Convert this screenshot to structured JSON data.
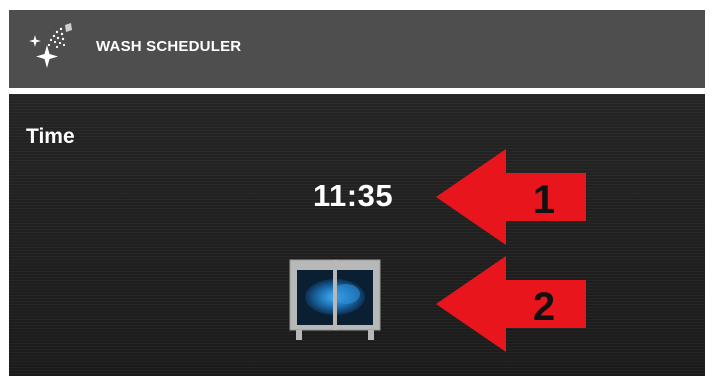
{
  "header": {
    "title": "WASH SCHEDULER",
    "logo_icon": "sparkle-spray-icon",
    "background": "#4e4e4e"
  },
  "main": {
    "section_label": "Time",
    "time_value": "11:35",
    "wash_icon": "wash-machine-icon"
  },
  "annotations": [
    {
      "label": "1",
      "icon": "red-arrow-left",
      "color": "#e8161c"
    },
    {
      "label": "2",
      "icon": "red-arrow-left",
      "color": "#e8161c"
    }
  ]
}
